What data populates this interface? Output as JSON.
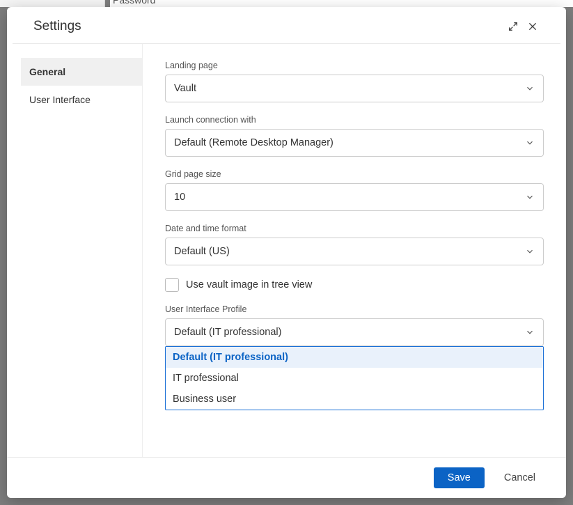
{
  "background": {
    "password_label": "Password"
  },
  "modal": {
    "title": "Settings",
    "sidebar": {
      "items": [
        {
          "label": "General",
          "active": true
        },
        {
          "label": "User Interface",
          "active": false
        }
      ]
    },
    "fields": {
      "landing_page": {
        "label": "Landing page",
        "value": "Vault"
      },
      "launch_connection": {
        "label": "Launch connection with",
        "value": "Default (Remote Desktop Manager)"
      },
      "grid_page_size": {
        "label": "Grid page size",
        "value": "10"
      },
      "date_time_format": {
        "label": "Date and time format",
        "value": "Default (US)"
      },
      "use_vault_image": {
        "label": "Use vault image in tree view",
        "checked": false
      },
      "ui_profile": {
        "label": "User Interface Profile",
        "value": "Default (IT professional)",
        "open": true,
        "options": [
          "Default (IT professional)",
          "IT professional",
          "Business user"
        ]
      }
    },
    "footer": {
      "save": "Save",
      "cancel": "Cancel"
    }
  }
}
